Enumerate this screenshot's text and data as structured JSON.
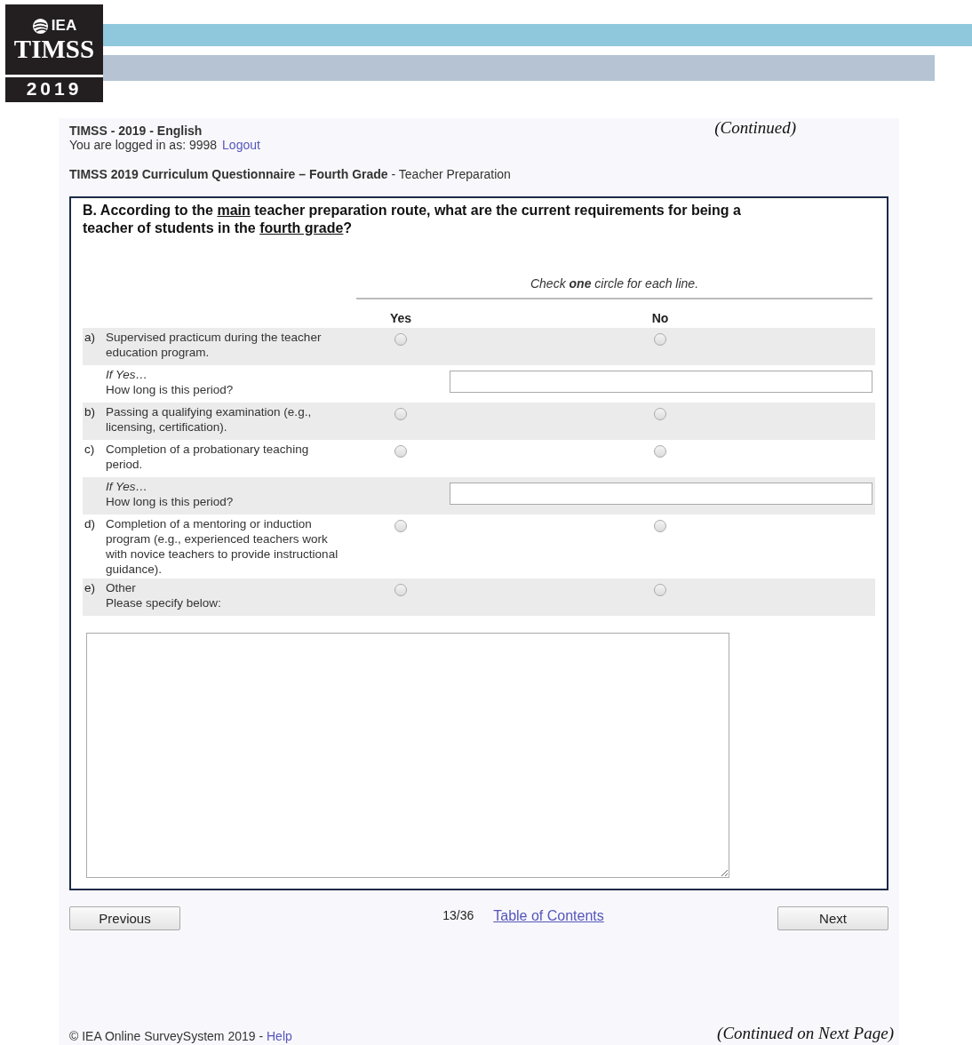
{
  "header": {
    "logo": {
      "org": "IEA",
      "name": "TIMSS",
      "year": "2019"
    },
    "note": "(Continued)"
  },
  "session": {
    "title": "TIMSS - 2019 - English",
    "login": "You are logged in as: 9998",
    "logout": "Logout"
  },
  "breadcrumb": "**TIMSS 2019 Curriculum Questionnaire – Fourth Grade** - Teacher Preparation",
  "question": {
    "parts": [
      {
        "text": "B. According to the ",
        "underlined": false
      },
      {
        "text": "main",
        "underlined": true
      },
      {
        "text": " teacher preparation route, what are the current requirements for being a teacher of students in the ",
        "underlined": false
      },
      {
        "text": "fourth grade",
        "underlined": true
      },
      {
        "text": "?",
        "underlined": false
      }
    ],
    "instruction": "Check **one** circle for each line.",
    "columns": [
      "Yes",
      "No"
    ],
    "rows": [
      {
        "kind": "item",
        "letter": "a)",
        "text": "Supervised practicum during the teacher education program.",
        "options": [
          {
            "selected": false
          },
          {
            "selected": false
          }
        ]
      },
      {
        "kind": "followup",
        "condition": "If Yes…",
        "prompt": "How long is this period?"
      },
      {
        "kind": "item",
        "letter": "b)",
        "text": "Passing a qualifying examination (e.g., licensing, certification).",
        "options": [
          {
            "selected": false
          },
          {
            "selected": false
          }
        ]
      },
      {
        "kind": "item",
        "letter": "c)",
        "text": "Completion of a probationary teaching period.",
        "options": [
          {
            "selected": false
          },
          {
            "selected": false
          }
        ]
      },
      {
        "kind": "followup",
        "condition": "If Yes…",
        "prompt": "How long is this period?"
      },
      {
        "kind": "item",
        "letter": "d)",
        "text": "Completion of a mentoring or induction program (e.g., experienced teachers work with novice teachers to provide instructional guidance).",
        "options": [
          {
            "selected": false
          },
          {
            "selected": false
          }
        ]
      },
      {
        "kind": "item",
        "letter": "e)",
        "text": "Other\nPlease specify below:",
        "options": [
          {
            "selected": false
          },
          {
            "selected": false
          }
        ]
      }
    ]
  },
  "navigation": {
    "previous": "Previous",
    "page": "13/36",
    "contents": "Table of Contents",
    "next": "Next"
  },
  "footer": {
    "copyright": "© IEA Online SurveySystem 2019 - ",
    "help": "Help",
    "note": "(Continued on Next Page)"
  }
}
